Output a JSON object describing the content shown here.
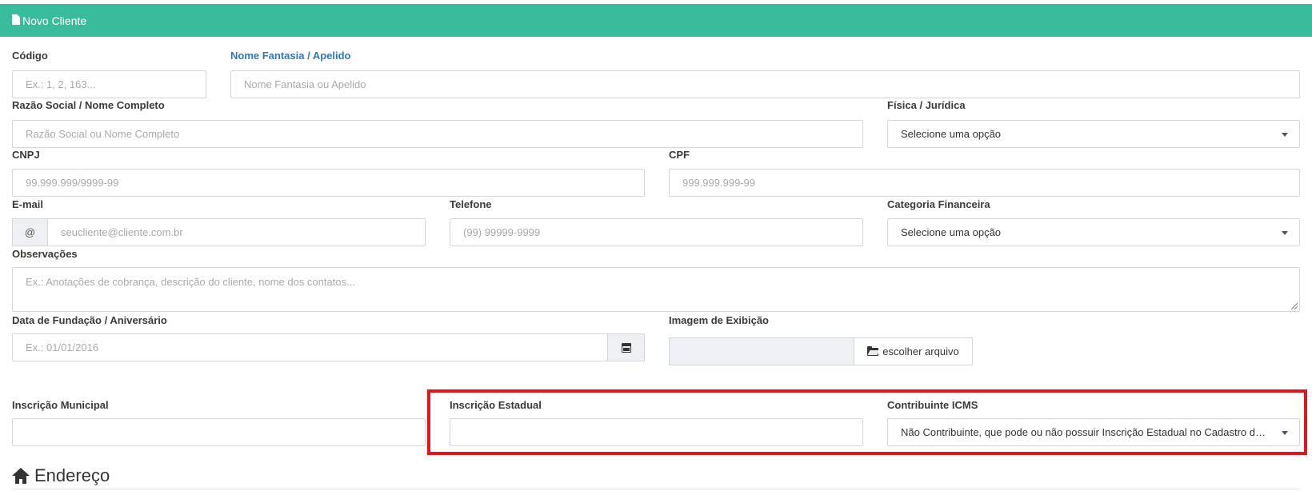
{
  "header": {
    "title": "Novo Cliente",
    "icon": "file-icon",
    "color": "#38bc9c"
  },
  "fields": {
    "codigo": {
      "label": "Código",
      "placeholder": "Ex.: 1, 2, 163..."
    },
    "nome_fantasia": {
      "label": "Nome Fantasia / Apelido",
      "placeholder": "Nome Fantasia ou Apelido"
    },
    "razao_social": {
      "label": "Razão Social / Nome Completo",
      "placeholder": "Razão Social ou Nome Completo"
    },
    "fisica_juridica": {
      "label": "Física / Jurídica",
      "value": "Selecione uma opção"
    },
    "cnpj": {
      "label": "CNPJ",
      "placeholder": "99.999.999/9999-99"
    },
    "cpf": {
      "label": "CPF",
      "placeholder": "999.999.999-99"
    },
    "email": {
      "label": "E-mail",
      "addon": "@",
      "placeholder": "seucliente@cliente.com.br"
    },
    "telefone": {
      "label": "Telefone",
      "placeholder": "(99) 99999-9999"
    },
    "categoria": {
      "label": "Categoria Financeira",
      "value": "Selecione uma opção"
    },
    "observacoes": {
      "label": "Observações",
      "placeholder": "Ex.: Anotações de cobrança, descrição do cliente, nome dos contatos..."
    },
    "data_fundacao": {
      "label": "Data de Fundação / Aniversário",
      "placeholder": "Ex.: 01/01/2016"
    },
    "imagem": {
      "label": "Imagem de Exibição",
      "button": "escolher arquivo"
    },
    "inscricao_municipal": {
      "label": "Inscrição Municipal",
      "value": ""
    },
    "inscricao_estadual": {
      "label": "Inscrição Estadual",
      "value": ""
    },
    "contribuinte_icms": {
      "label": "Contribuinte ICMS",
      "value": "Não Contribuinte, que pode ou não possuir Inscrição Estadual no Cadastro de Contribuintes"
    }
  },
  "section": {
    "title": "Endereço",
    "icon": "home-icon"
  },
  "highlight_color": "#e3141b"
}
